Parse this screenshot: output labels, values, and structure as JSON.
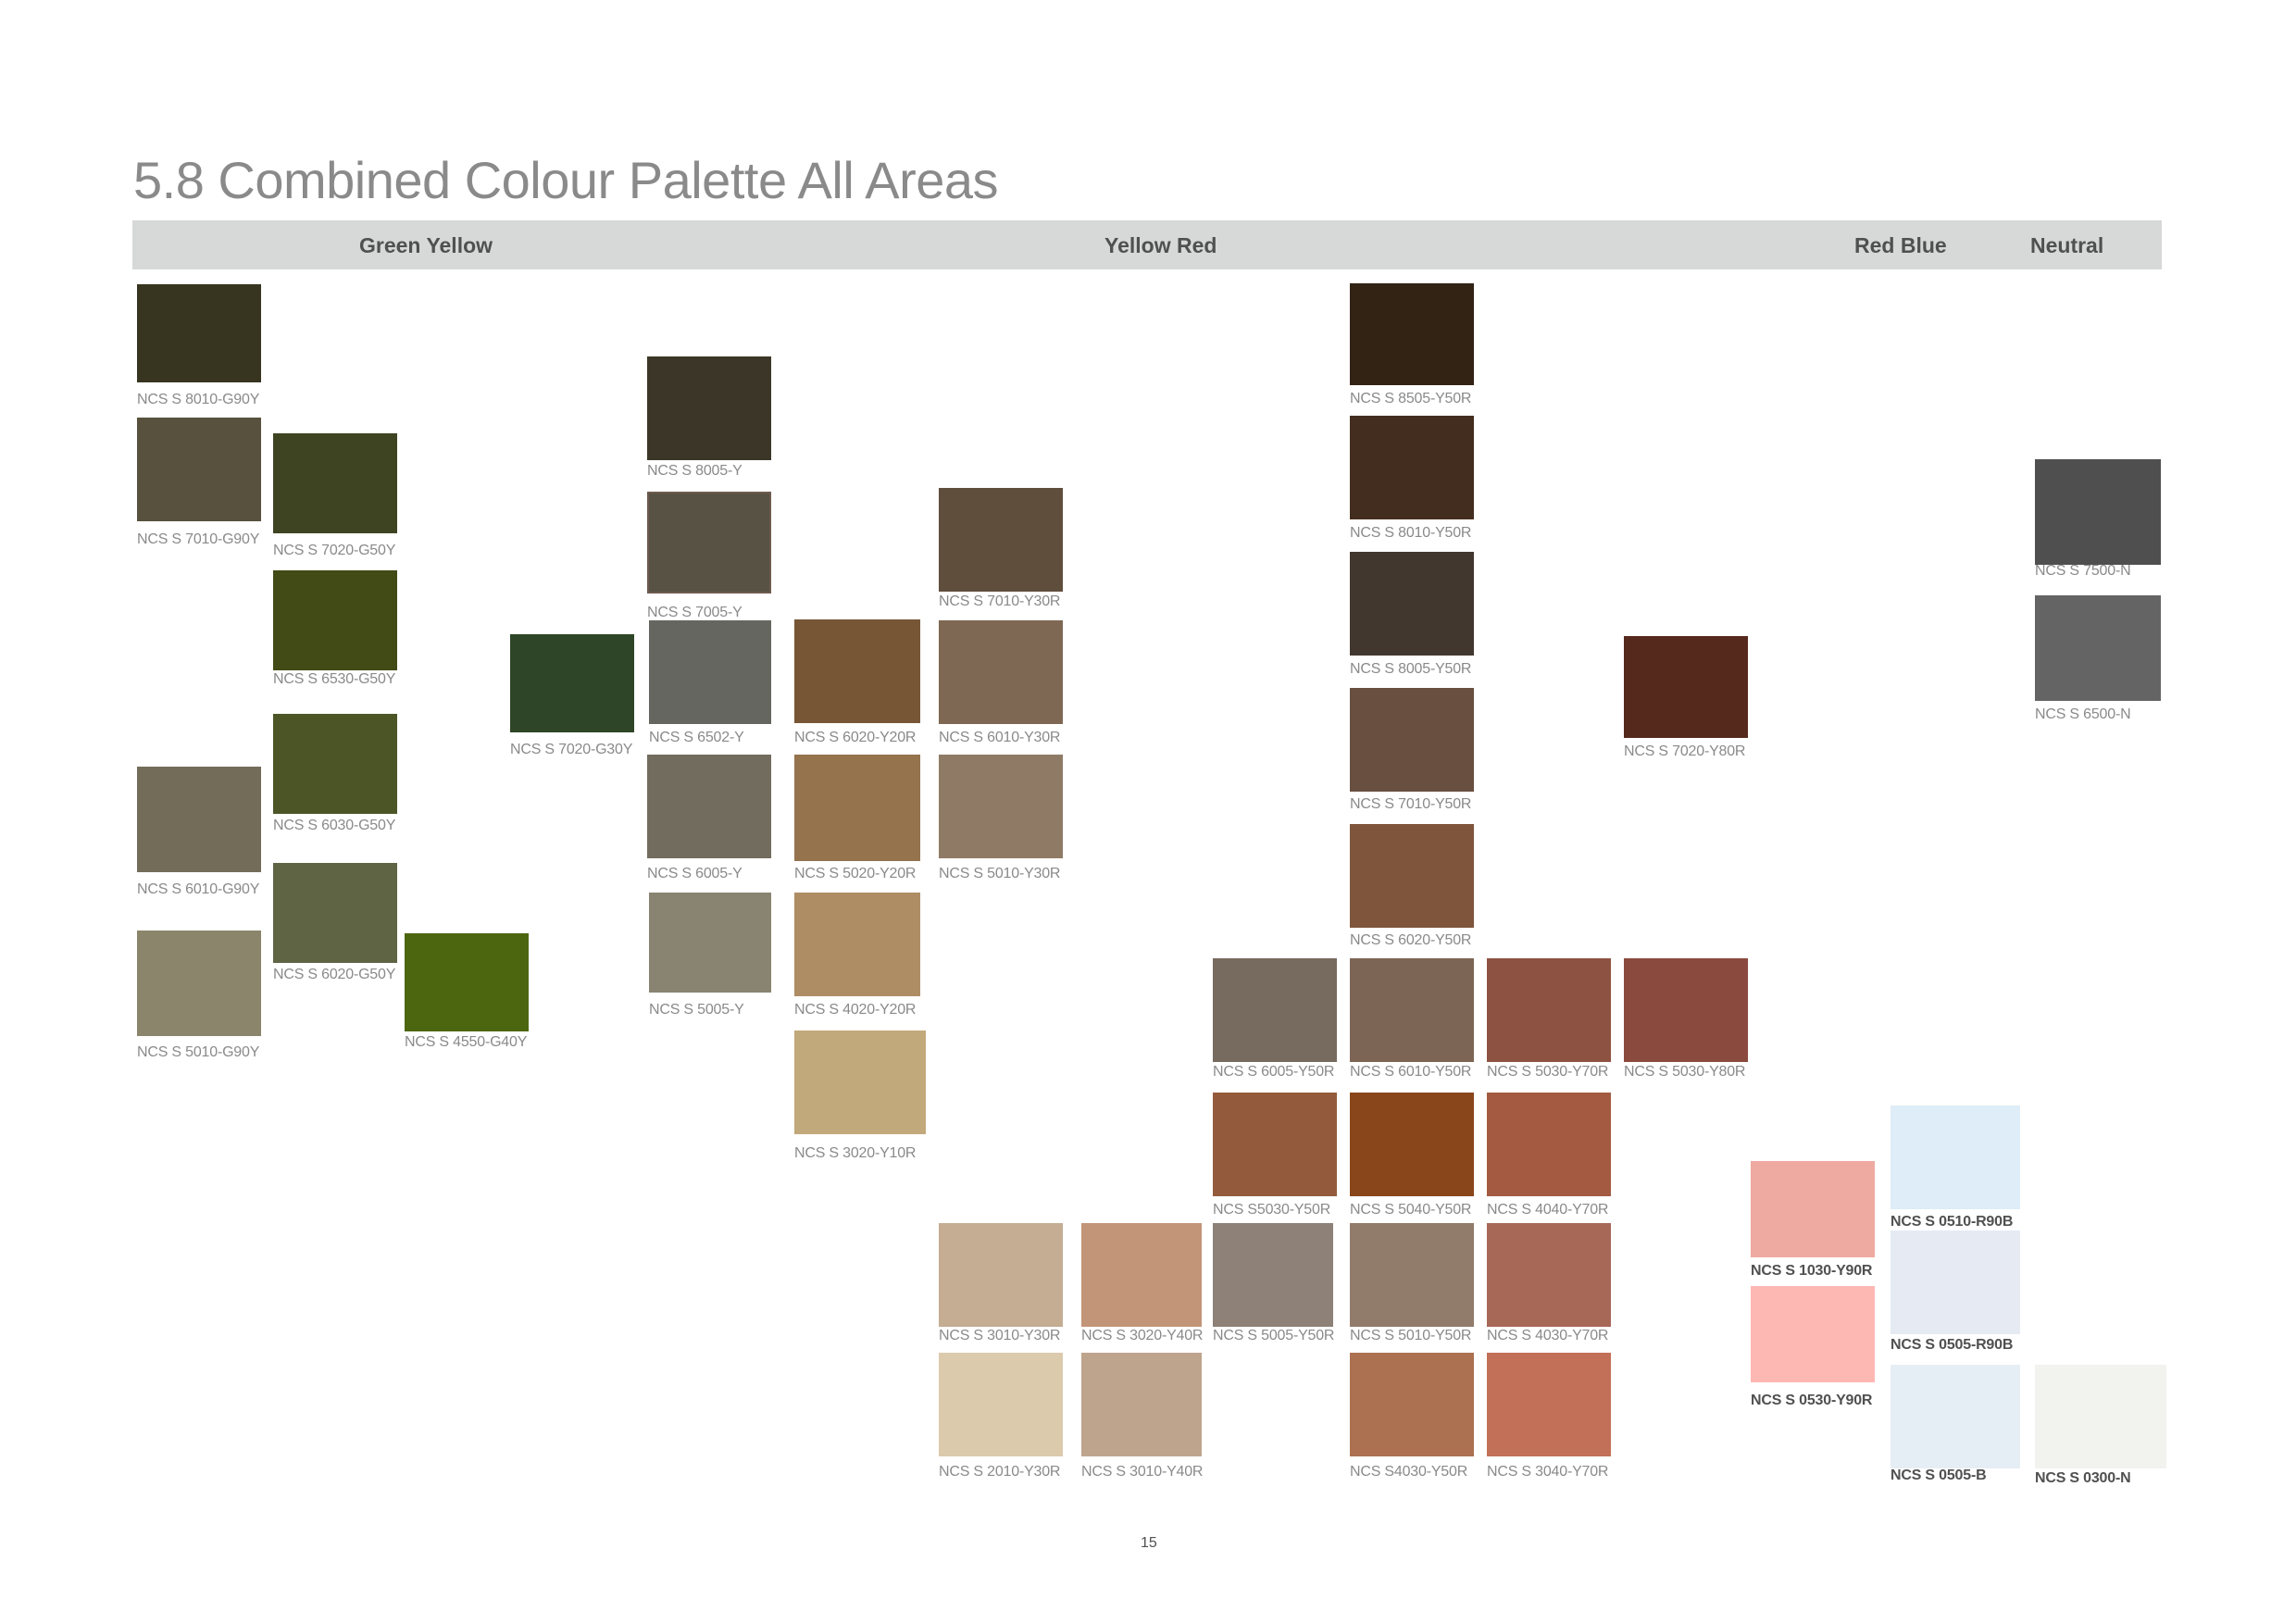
{
  "title": "5.8 Combined Colour Palette All Areas",
  "categories": [
    "Green Yellow",
    "Yellow Red",
    "Red Blue",
    "Neutral"
  ],
  "swatches": [
    {
      "code": "NCS S 8010-G90Y",
      "color": "#373420"
    },
    {
      "code": "NCS S 7010-G90Y",
      "color": "#57513d"
    },
    {
      "code": "NCS S 6010-G90Y",
      "color": "#736c59"
    },
    {
      "code": "NCS S 5010-G90Y",
      "color": "#8a856b"
    },
    {
      "code": "NCS S 7020-G50Y",
      "color": "#3e4421"
    },
    {
      "code": "NCS S 6530-G50Y",
      "color": "#424a16"
    },
    {
      "code": "NCS S 6030-G50Y",
      "color": "#4c5526"
    },
    {
      "code": "NCS S 6020-G50Y",
      "color": "#5f6445"
    },
    {
      "code": "NCS S 4550-G40Y",
      "color": "#4c6610"
    },
    {
      "code": "NCS S 7020-G30Y",
      "color": "#2e4627"
    },
    {
      "code": "NCS S 8005-Y",
      "color": "#3b3627"
    },
    {
      "code": "NCS S 7005-Y",
      "color": "#575244"
    },
    {
      "code": "NCS S 6502-Y",
      "color": "#666661"
    },
    {
      "code": "NCS S 6005-Y",
      "color": "#716c5e"
    },
    {
      "code": "NCS S 5005-Y",
      "color": "#898371"
    },
    {
      "code": "NCS S 6020-Y20R",
      "color": "#775636"
    },
    {
      "code": "NCS S 5020-Y20R",
      "color": "#94734d"
    },
    {
      "code": "NCS S 4020-Y20R",
      "color": "#ae8d64"
    },
    {
      "code": "NCS S 3020-Y10R",
      "color": "#c2a97b"
    },
    {
      "code": "NCS S 7010-Y30R",
      "color": "#604e3d"
    },
    {
      "code": "NCS S 6010-Y30R",
      "color": "#7e6853"
    },
    {
      "code": "NCS S 5010-Y30R",
      "color": "#8f7b65"
    },
    {
      "code": "NCS S 3010-Y30R",
      "color": "#c4ad93"
    },
    {
      "code": "NCS S 2010-Y30R",
      "color": "#dccaad"
    },
    {
      "code": "NCS S 3020-Y40R",
      "color": "#c29579"
    },
    {
      "code": "NCS S 3010-Y40R",
      "color": "#bea48d"
    },
    {
      "code": "NCS S 6005-Y50R",
      "color": "#776a5f"
    },
    {
      "code": "NCS S5030-Y50R",
      "color": "#935b3c"
    },
    {
      "code": "NCS S 5005-Y50R",
      "color": "#8d8178"
    },
    {
      "code": "NCS S 8505-Y50R",
      "color": "#322315"
    },
    {
      "code": "NCS S 8010-Y50R",
      "color": "#432d1e"
    },
    {
      "code": "NCS S 8005-Y50R",
      "color": "#42372f"
    },
    {
      "code": "NCS S 7010-Y50R",
      "color": "#684f40"
    },
    {
      "code": "NCS S 6020-Y50R",
      "color": "#7f553b"
    },
    {
      "code": "NCS S 6010-Y50R",
      "color": "#7d6556"
    },
    {
      "code": "NCS S 5040-Y50R",
      "color": "#8a461b"
    },
    {
      "code": "NCS S 5010-Y50R",
      "color": "#917b6b"
    },
    {
      "code": "NCS S4030-Y50R",
      "color": "#ab7150"
    },
    {
      "code": "NCS S 5030-Y70R",
      "color": "#8d5241"
    },
    {
      "code": "NCS S 4040-Y70R",
      "color": "#a35a40"
    },
    {
      "code": "NCS S 4030-Y70R",
      "color": "#a86858"
    },
    {
      "code": "NCS S 3040-Y70R",
      "color": "#c27057"
    },
    {
      "code": "NCS S 7020-Y80R",
      "color": "#55291c"
    },
    {
      "code": "NCS S 5030-Y80R",
      "color": "#8a4b3e"
    },
    {
      "code": "NCS S 1030-Y90R",
      "color": "#eea9a0"
    },
    {
      "code": "NCS S 0530-Y90R",
      "color": "#feb8b4"
    },
    {
      "code": "NCS S 0510-R90B",
      "color": "#deedf7"
    },
    {
      "code": "NCS S 0505-R90B",
      "color": "#e6ebf3"
    },
    {
      "code": "NCS S 0505-B",
      "color": "#e6eef5"
    },
    {
      "code": "NCS S 7500-N",
      "color": "#4f4f4f"
    },
    {
      "code": "NCS S 6500-N",
      "color": "#646464"
    },
    {
      "code": "NCS S 0300-N",
      "color": "#f2f3ef"
    }
  ],
  "page_number": "15"
}
